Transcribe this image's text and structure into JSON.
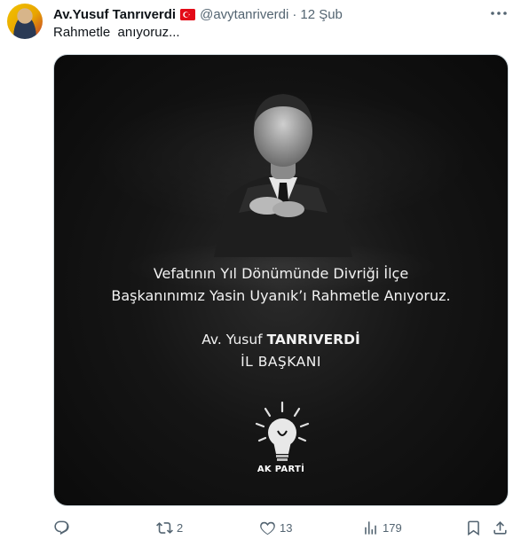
{
  "tweet": {
    "author": {
      "display_name": "Av.Yusuf Tanrıverdi",
      "handle": "@avytanriverdi",
      "badge": "turkey-flag-icon"
    },
    "separator": "·",
    "date": "12 Şub",
    "text": "Rahmetle  anıyoruz...",
    "media": {
      "line1": "Vefatının Yıl Dönümünde Divriği İlçe",
      "line2": "Başkanınımız Yasin Uyanık’ı Rahmetle Anıyoruz.",
      "name_regular": "Av. Yusuf ",
      "name_bold": "TANRIVERDİ",
      "title": "İL BAŞKANI",
      "party_label": "AK PARTİ"
    },
    "actions": {
      "reply_count": "",
      "retweet_count": "2",
      "like_count": "13",
      "views_count": "179"
    }
  },
  "colors": {
    "text_primary": "#0f1419",
    "text_secondary": "#536471",
    "flag_red": "#e30a17",
    "media_background": "#111111"
  }
}
